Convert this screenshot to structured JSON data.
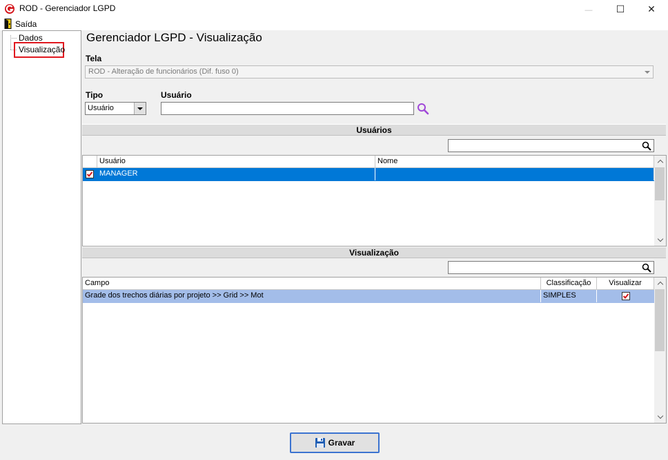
{
  "window": {
    "title": "ROD - Gerenciador LGPD",
    "controls": {
      "minimize": "—",
      "maximize": "☐",
      "close": "✕"
    }
  },
  "menu": {
    "exit_label": "Saída"
  },
  "tree": {
    "items": [
      {
        "label": "Dados"
      },
      {
        "label": "Visualização",
        "selected": true
      }
    ]
  },
  "main": {
    "title": "Gerenciador LGPD - Visualização",
    "tela": {
      "label": "Tela",
      "value": "ROD - Alteração de funcionários (Dif. fuso 0)"
    },
    "tipo": {
      "label": "Tipo",
      "value": "Usuário"
    },
    "usuario": {
      "label": "Usuário",
      "value": ""
    }
  },
  "usuarios_section": {
    "header": "Usuários",
    "filter_value": "",
    "columns": [
      "Usuário",
      "Nome"
    ],
    "rows": [
      {
        "checked": true,
        "usuario": "MANAGER",
        "nome": ""
      }
    ]
  },
  "visualizacao_section": {
    "header": "Visualização",
    "filter_value": "",
    "columns": [
      "Campo",
      "Classificação",
      "Visualizar"
    ],
    "rows": [
      {
        "campo": "Grade dos trechos diárias por projeto >> Grid >> Mot",
        "classificacao": "SIMPLES",
        "visualizar": true
      }
    ]
  },
  "footer": {
    "save_label": "Gravar"
  },
  "colors": {
    "selection": "#0078d7",
    "row_highlight": "#a3bde9",
    "accent_red": "#e0181f"
  }
}
